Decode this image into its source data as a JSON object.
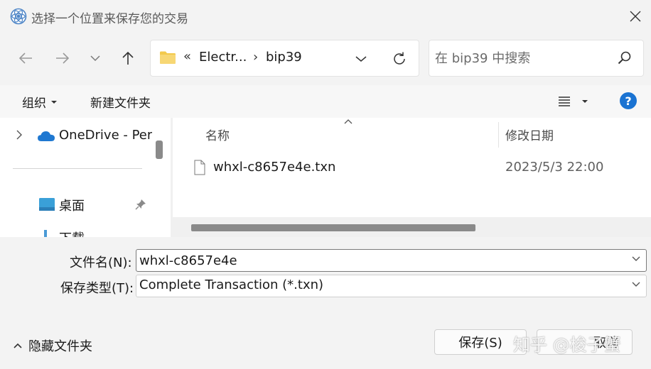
{
  "window": {
    "title": "选择一个位置来保存您的交易",
    "app_icon": "electrum-icon"
  },
  "nav": {
    "back_icon": "arrow-left-icon",
    "forward_icon": "arrow-right-icon",
    "recent_icon": "chevron-down-icon",
    "up_icon": "arrow-up-icon"
  },
  "address": {
    "overflow": "«",
    "crumbs": [
      "Electr...",
      "bip39"
    ],
    "separator": "›"
  },
  "search": {
    "placeholder": "在 bip39 中搜索"
  },
  "toolbar": {
    "organize_label": "组织",
    "new_folder_label": "新建文件夹",
    "help_label": "?"
  },
  "nav_pane": {
    "items": [
      {
        "label": "OneDrive - Per",
        "icon": "cloud-icon"
      },
      {
        "label": "桌面",
        "icon": "desktop-icon"
      },
      {
        "label": "下载",
        "icon": "download-icon"
      }
    ]
  },
  "file_list": {
    "columns": {
      "name": "名称",
      "date": "修改日期"
    },
    "files": [
      {
        "name": "whxl-c8657e4e.txn",
        "date": "2023/5/3 22:00"
      }
    ]
  },
  "save_form": {
    "filename_label": "文件名(N):",
    "filename_value": "whxl-c8657e4e",
    "filetype_label": "保存类型(T):",
    "filetype_value": "Complete Transaction (*.txn)"
  },
  "footer": {
    "hide_folders_label": "隐藏文件夹",
    "save_label": "保存(S)",
    "cancel_label": "取消"
  },
  "watermark": "知乎 @梭子蟹",
  "colors": {
    "accent": "#1a73d2",
    "folder": "#f2c94c",
    "onedrive": "#1f78d1"
  }
}
